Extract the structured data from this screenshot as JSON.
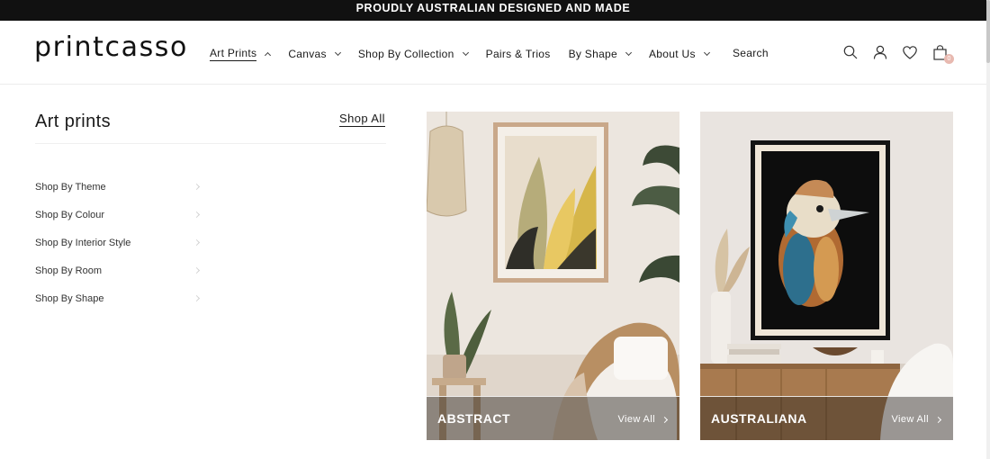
{
  "announcement": "PROUDLY AUSTRALIAN DESIGNED AND MADE",
  "brand": {
    "logo_text": "printcasso"
  },
  "nav": {
    "items": [
      {
        "label": "Art Prints",
        "has_dropdown": true,
        "expanded": true,
        "active": true
      },
      {
        "label": "Canvas",
        "has_dropdown": true
      },
      {
        "label": "Shop By Collection",
        "has_dropdown": true
      },
      {
        "label": "Pairs & Trios",
        "has_dropdown": false
      },
      {
        "label": "By Shape",
        "has_dropdown": true
      },
      {
        "label": "About Us",
        "has_dropdown": true
      }
    ],
    "search_label": "Search"
  },
  "header_icons": [
    "search-icon",
    "account-icon",
    "wishlist-heart-icon",
    "cart-bag-icon"
  ],
  "cart": {
    "count": "0",
    "badge_color": "#e8b9b0"
  },
  "mega_menu": {
    "title": "Art prints",
    "shop_all": "Shop All",
    "links": [
      {
        "label": "Shop By Theme"
      },
      {
        "label": "Shop By Colour"
      },
      {
        "label": "Shop By Interior Style"
      },
      {
        "label": "Shop By Room"
      },
      {
        "label": "Shop By Shape"
      }
    ],
    "cards": [
      {
        "name": "ABSTRACT",
        "cta": "View All"
      },
      {
        "name": "AUSTRALIANA",
        "cta": "View All"
      }
    ]
  },
  "colors": {
    "topbar_bg": "#111111",
    "text": "#1a1a1a"
  }
}
